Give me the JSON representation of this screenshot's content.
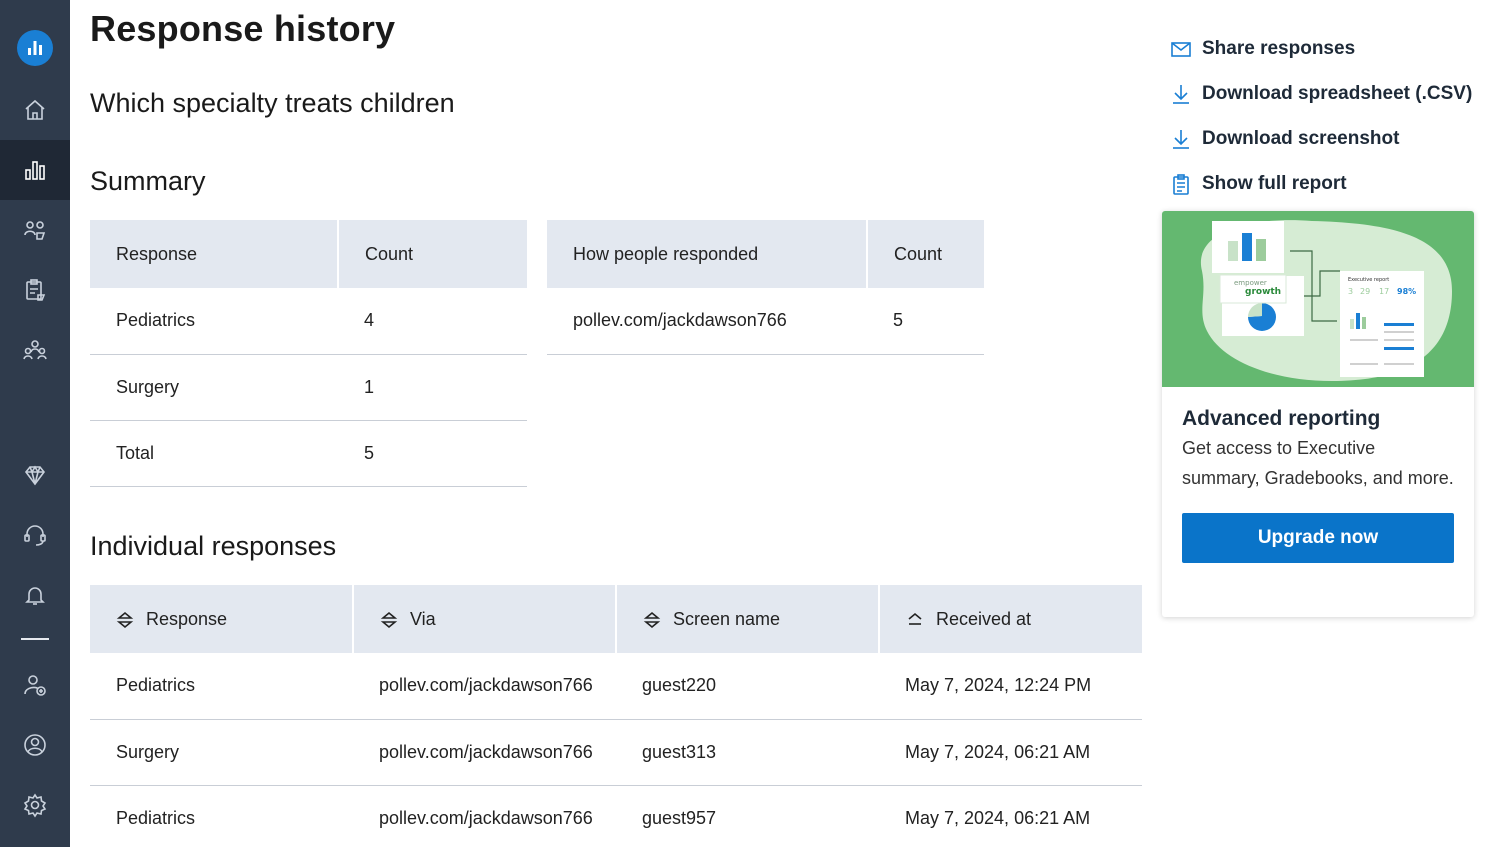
{
  "page": {
    "title": "Response history",
    "question": "Which specialty treats children"
  },
  "summary": {
    "heading": "Summary",
    "response_table": {
      "headers": [
        "Response",
        "Count"
      ],
      "rows": [
        [
          "Pediatrics",
          "4"
        ],
        [
          "Surgery",
          "1"
        ],
        [
          "Total",
          "5"
        ]
      ]
    },
    "via_table": {
      "headers": [
        "How people responded",
        "Count"
      ],
      "rows": [
        [
          "pollev.com/jackdawson766",
          "5"
        ]
      ]
    }
  },
  "individual": {
    "heading": "Individual responses",
    "headers": [
      "Response",
      "Via",
      "Screen name",
      "Received at"
    ],
    "rows": [
      [
        "Pediatrics",
        "pollev.com/jackdawson766",
        "guest220",
        "May 7, 2024, 12:24 PM"
      ],
      [
        "Surgery",
        "pollev.com/jackdawson766",
        "guest313",
        "May 7, 2024, 06:21 AM"
      ],
      [
        "Pediatrics",
        "pollev.com/jackdawson766",
        "guest957",
        "May 7, 2024, 06:21 AM"
      ]
    ]
  },
  "actions": {
    "share": "Share responses",
    "download_csv": "Download spreadsheet (.CSV)",
    "download_screenshot": "Download screenshot",
    "full_report": "Show full report"
  },
  "promo": {
    "title": "Advanced reporting",
    "text": "Get access to Executive summary, Gradebooks, and more.",
    "button": "Upgrade now",
    "art_text": {
      "empower": "empower",
      "growth": "growth",
      "report_title": "Executive report",
      "stats": [
        "3",
        "29",
        "17",
        "98%"
      ]
    }
  },
  "sidebar": {
    "icons": [
      "logo-icon",
      "home-icon",
      "results-icon",
      "participants-icon",
      "reports-icon",
      "groups-icon",
      "premium-icon",
      "support-icon",
      "notifications-icon",
      "add-user-icon",
      "profile-icon",
      "settings-icon"
    ]
  },
  "colors": {
    "sidebar": "#2f3b4c",
    "sidebar_active": "#1f2835",
    "accent": "#0a74c9",
    "table_header": "#e3e8f0",
    "promo_green": "#64b870"
  }
}
